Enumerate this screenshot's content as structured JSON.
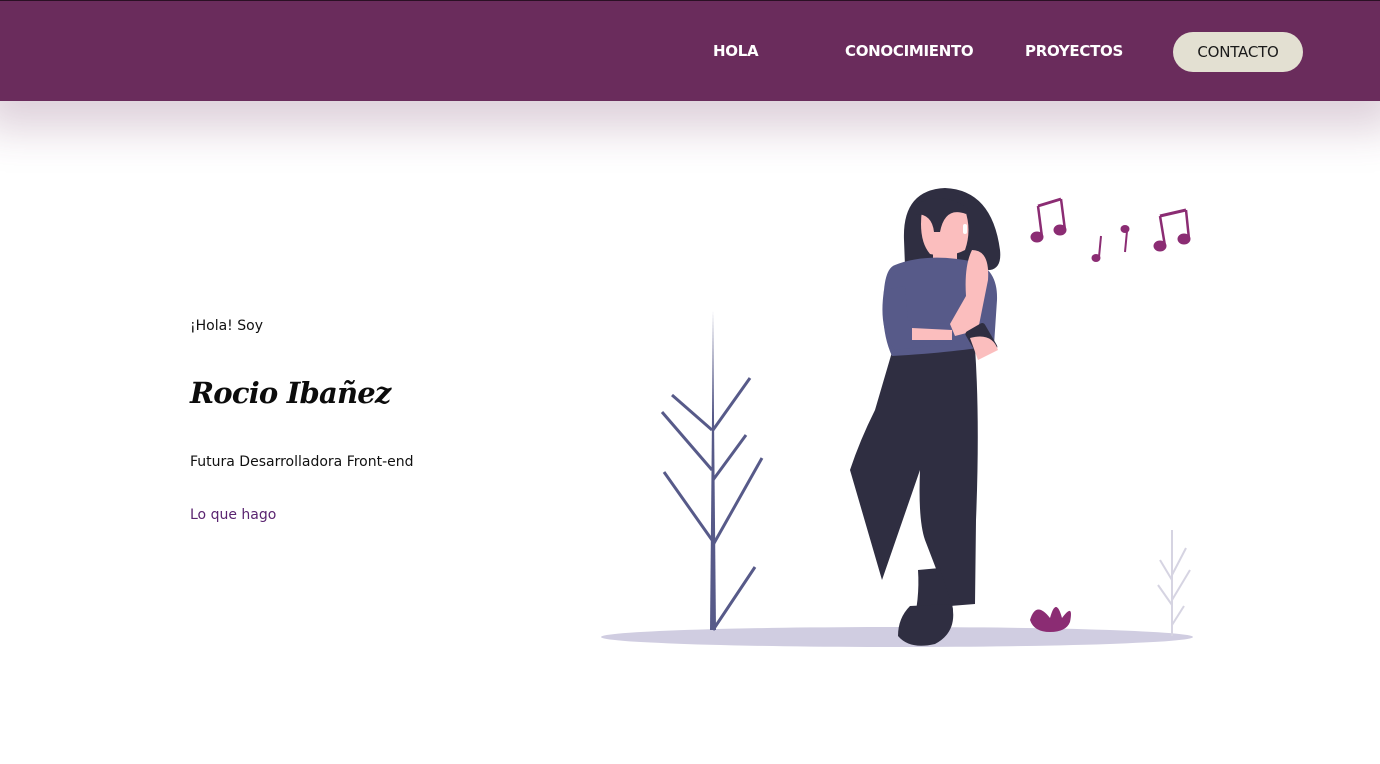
{
  "nav": {
    "items": [
      {
        "label": "HOLA"
      },
      {
        "label": "CONOCIMIENTO"
      },
      {
        "label": "PROYECTOS"
      }
    ],
    "contact_label": "CONTACTO"
  },
  "hero": {
    "intro": "¡Hola! Soy",
    "name": "Rocio Ibañez",
    "role": "Futura Desarrolladora Front-end",
    "cta_label": "Lo que hago"
  },
  "colors": {
    "navbar": "#6a2c5c",
    "contact_button": "#e3e0d2",
    "link": "#5a2470",
    "accent": "#8b2c73",
    "shirt": "#575a89",
    "pants": "#2f2e41",
    "skin": "#fbbebe",
    "ground": "#d0cde1"
  },
  "illustration": {
    "icons": [
      "music-notes-icon",
      "woman-listening-figure",
      "plant-icon",
      "flower-icon"
    ]
  }
}
